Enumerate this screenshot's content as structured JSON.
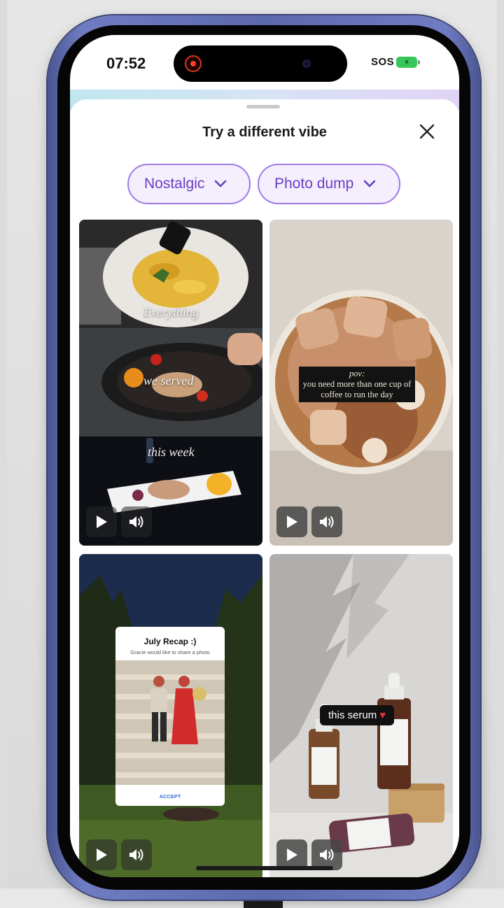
{
  "status_bar": {
    "time": "07:52",
    "sos": "SOS",
    "battery_icon": "battery-charging-icon",
    "recording_icon": "screen-recording-icon"
  },
  "sheet": {
    "title": "Try a different vibe",
    "close_icon": "close-icon",
    "filters": [
      {
        "label": "Nostalgic",
        "icon": "chevron-down-icon"
      },
      {
        "label": "Photo dump",
        "icon": "chevron-down-icon"
      }
    ]
  },
  "templates": [
    {
      "overlay_texts": [
        "Everything",
        "we served",
        "this week"
      ],
      "controls": [
        "play-icon",
        "volume-icon"
      ]
    },
    {
      "caption_poc": "pov:",
      "caption_body": "you need more than one cup of coffee to run the day",
      "controls": [
        "play-icon",
        "volume-icon"
      ]
    },
    {
      "card_title": "July Recap :)",
      "card_subtitle": "Gracie would like to share a photo",
      "card_action": "ACCEPT",
      "controls": [
        "play-icon",
        "volume-icon"
      ]
    },
    {
      "tag_text": "this serum",
      "tag_emoji": "♥",
      "controls": [
        "play-icon",
        "volume-icon"
      ]
    }
  ],
  "colors": {
    "chip_border": "#9f7ae5",
    "chip_text": "#6a3fc2",
    "chip_bg": "#f4eefd",
    "phone_frame": "#5c69ad"
  }
}
